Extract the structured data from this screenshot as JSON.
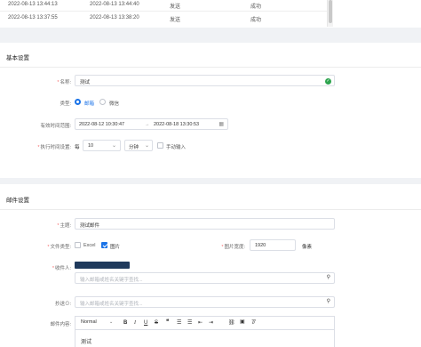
{
  "log_table": {
    "rows": [
      {
        "created": "2022-08-13 13:44:13",
        "sent": "2022-08-13 13:44:40",
        "type": "发送",
        "status": "成功"
      },
      {
        "created": "2022-08-13 13:37:55",
        "sent": "2022-08-13 13:38:20",
        "type": "发送",
        "status": "成功"
      }
    ]
  },
  "basic": {
    "section_title": "基本设置",
    "name_label": "名称:",
    "name_value": "测试",
    "type_label": "类型:",
    "type_options": [
      "邮箱",
      "微信"
    ],
    "type_selected": "邮箱",
    "period_label": "有效时间范围:",
    "period_start": "2022-08-12 10:30:47",
    "period_sep": "→",
    "period_end": "2022-08-18 13:30:53",
    "exec_label": "执行时间设置:",
    "exec_prefix": "每",
    "exec_value": "10",
    "exec_unit": "分钟",
    "manual_label": "手动输入"
  },
  "mail": {
    "section_title": "邮件设置",
    "subject_label": "主题:",
    "subject_value": "测试邮件",
    "filetype_label": "文件类型:",
    "filetype_options": [
      "Excel",
      "图片"
    ],
    "filetype_checked": [
      "图片"
    ],
    "imgwidth_label": "图片宽度:",
    "imgwidth_value": "1920",
    "imgwidth_unit": "像素",
    "recipients_label": "收件人:",
    "recipient_tag": "",
    "recipients_placeholder": "输入邮箱或姓名关键字查找...",
    "cc_label": "抄送⊙:",
    "cc_placeholder": "输入邮箱或姓名关键字查找...",
    "content_label": "邮件内容:",
    "editor_format": "Normal",
    "editor_body": "测试"
  },
  "colors": {
    "primary": "#1a73e8",
    "success": "#2ea44f",
    "required": "#f56c6c",
    "tag_bg": "#1f3a5c"
  },
  "icons": [
    "check-circle-icon",
    "calendar-icon",
    "chevron-down-icon",
    "search-icon",
    "bold-icon",
    "italic-icon",
    "underline-icon",
    "strike-icon",
    "quote-icon",
    "ordered-list-icon",
    "bullet-list-icon",
    "outdent-icon",
    "indent-icon",
    "link-icon",
    "image-icon",
    "clear-format-icon"
  ]
}
